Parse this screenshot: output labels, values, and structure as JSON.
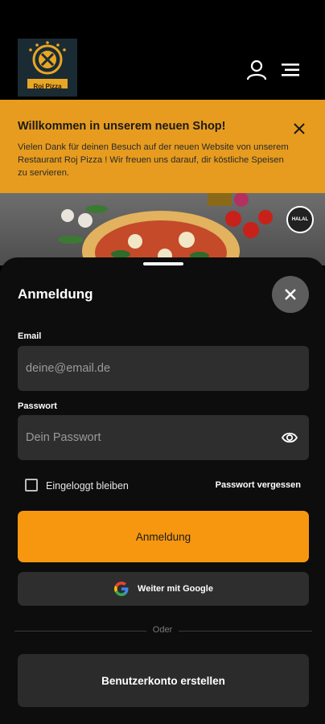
{
  "header": {
    "logo_text": "Roj Pizza",
    "user_icon": "user-icon",
    "menu_icon": "hamburger-menu-icon"
  },
  "banner": {
    "title": "Willkommen in unserem neuen Shop!",
    "text": "Vielen Dank für deinen Besuch auf der neuen Website von unserem Restaurant Roj Pizza ! Wir freuen uns darauf, dir köstliche Speisen zu servieren.",
    "close_icon": "close-icon"
  },
  "hero": {
    "badge": "HALAL"
  },
  "login": {
    "title": "Anmeldung",
    "email_label": "Email",
    "email_placeholder": "deine@email.de",
    "email_value": "",
    "password_label": "Passwort",
    "password_placeholder": "Dein Passwort",
    "password_value": "",
    "remember_label": "Eingeloggt bleiben",
    "remember_checked": false,
    "forgot_label": "Passwort vergessen",
    "submit_label": "Anmeldung",
    "google_label": "Weiter mit Google",
    "divider_label": "Oder",
    "register_label": "Benutzerkonto erstellen"
  },
  "colors": {
    "accent": "#f7970f",
    "banner": "#e79c1f",
    "sheet": "#0d0d0d",
    "field": "#2e2e2e"
  }
}
